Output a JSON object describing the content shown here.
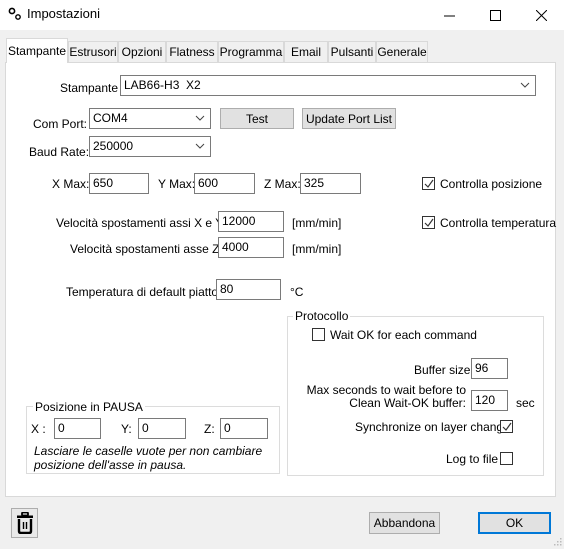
{
  "window": {
    "title": "Impostazioni",
    "icon": "gears-icon",
    "controls": {
      "minimize": "minimize-icon",
      "maximize": "maximize-icon",
      "close": "close-icon"
    }
  },
  "tabs": [
    {
      "label": "Stampante",
      "active": true
    },
    {
      "label": "Estrusori",
      "active": false
    },
    {
      "label": "Opzioni",
      "active": false
    },
    {
      "label": "Flatness",
      "active": false
    },
    {
      "label": "Programma",
      "active": false
    },
    {
      "label": "Email",
      "active": false
    },
    {
      "label": "Pulsanti",
      "active": false
    },
    {
      "label": "Generale",
      "active": false
    }
  ],
  "printer": {
    "label": "Stampante",
    "value": "LAB66-H3  X2"
  },
  "comport": {
    "label": "Com Port:",
    "value": "COM4",
    "test_label": "Test",
    "update_label": "Update Port List"
  },
  "baud": {
    "label": "Baud Rate:",
    "value": "250000"
  },
  "max": {
    "x_label": "X Max:",
    "x_value": "650",
    "y_label": "Y Max:",
    "y_value": "600",
    "z_label": "Z Max:",
    "z_value": "325"
  },
  "checks": {
    "position": {
      "label": "Controlla posizione",
      "checked": true
    },
    "temperature": {
      "label": "Controlla temperatura",
      "checked": true
    }
  },
  "speed": {
    "xy_label": "Velocità spostamenti assi X e Y :",
    "xy_value": "12000",
    "xy_unit": "[mm/min]",
    "z_label": "Velocità spostamenti asse Z :",
    "z_value": "4000",
    "z_unit": "[mm/min]"
  },
  "bed_temp": {
    "label": "Temperatura di default piatto :",
    "value": "80",
    "unit": "°C"
  },
  "protocol": {
    "title": "Protocollo",
    "wait_ok": {
      "label": "Wait OK for each command",
      "checked": false
    },
    "buffer_label": "Buffer size:",
    "buffer_value": "96",
    "max_wait_label_1": "Max seconds to wait before to",
    "max_wait_label_2": "Clean Wait-OK buffer:",
    "max_wait_value": "120",
    "max_wait_unit": "sec",
    "sync": {
      "label": "Synchronize on layer change",
      "checked": true
    },
    "log": {
      "label": "Log to file",
      "checked": false
    }
  },
  "pause": {
    "title": "Posizione in PAUSA",
    "x_label": "X :",
    "x_value": "0",
    "y_label": "Y:",
    "y_value": "0",
    "z_label": "Z:",
    "z_value": "0",
    "hint_1": "Lasciare le caselle vuote per non cambiare",
    "hint_2": "posizione dell'asse in pausa."
  },
  "footer": {
    "delete_icon": "trash-icon",
    "cancel_label": "Abbandona",
    "ok_label": "OK"
  },
  "colors": {
    "window_bg": "#f0f0f0",
    "panel_bg": "#ffffff",
    "ok_border": "#0078d7"
  }
}
